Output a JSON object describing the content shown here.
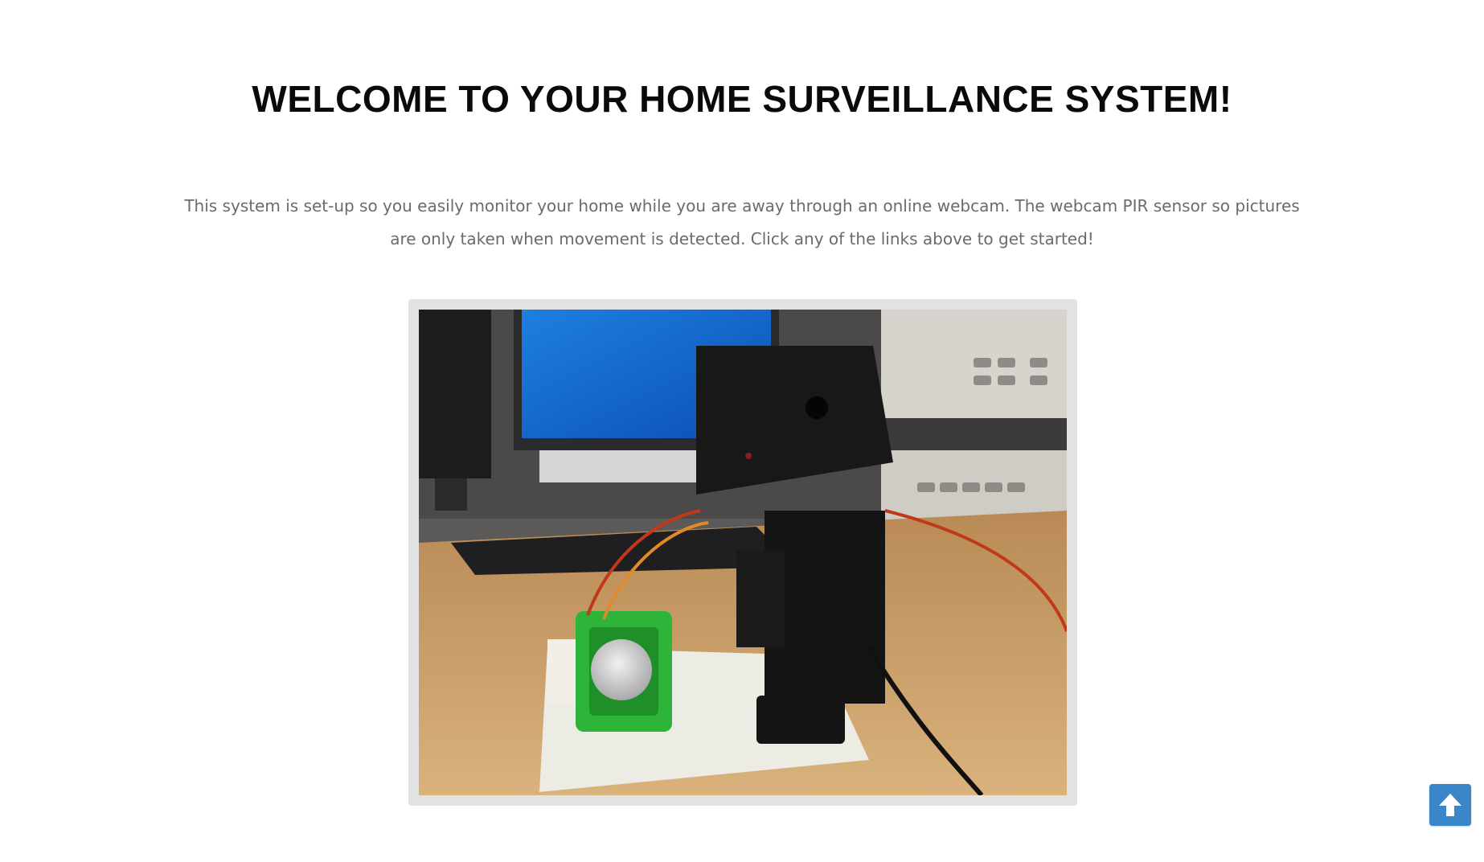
{
  "page": {
    "title": "WELCOME TO YOUR HOME SURVEILLANCE SYSTEM!",
    "intro": "This system is set-up so you easily monitor your home while you are away through an online webcam. The webcam PIR sensor so pictures are only taken when movement is detected. Click any of the links above to get started!"
  },
  "hero_image": {
    "subject": "pan-tilt webcam with PIR motion sensor on a lab bench",
    "icon": "photo-image"
  },
  "back_to_top": {
    "icon": "arrow-up-icon"
  },
  "colors": {
    "title": "#0a0a0a",
    "intro_text": "#6b6b6b",
    "frame": "#e2e2e2",
    "back_to_top_bg": "#3a86c8"
  }
}
